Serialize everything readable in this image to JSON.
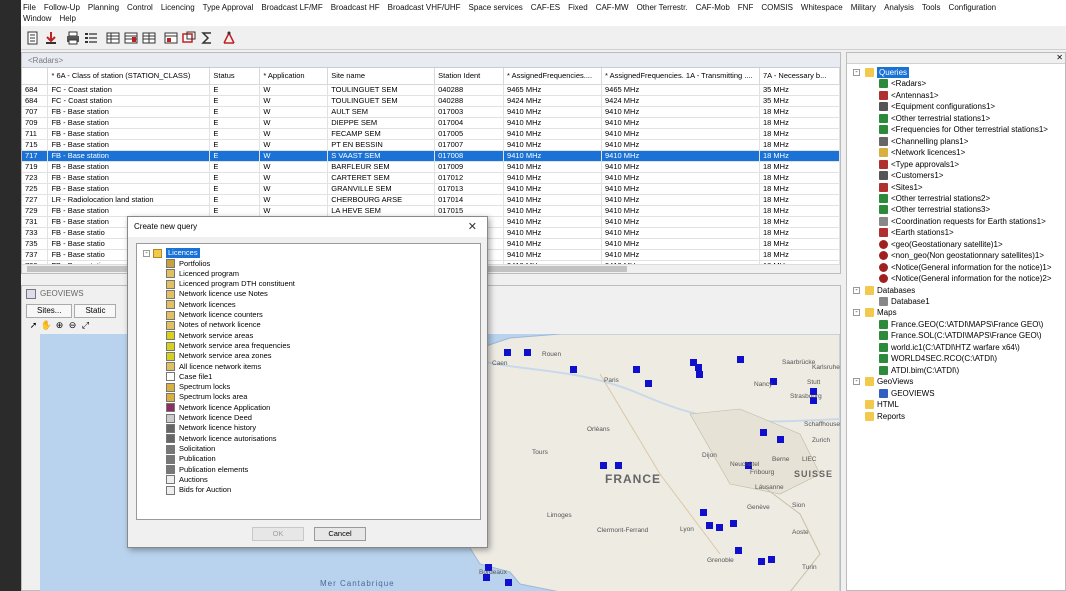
{
  "menu": {
    "row1": [
      "File",
      "Follow-Up",
      "Planning",
      "Control",
      "Licencing",
      "Type Approval",
      "Broadcast LF/MF",
      "Broadcast HF",
      "Broadcast VHF/UHF",
      "Space services",
      "CAF-ES",
      "Fixed",
      "CAF-MW",
      "Other Terrestr.",
      "CAF-Mob",
      "FNF",
      "COMSIS",
      "Whitespace",
      "Military",
      "Analysis",
      "Tools",
      "Configuration"
    ],
    "row2": [
      "Window",
      "Help"
    ]
  },
  "table": {
    "title": "<Radars>",
    "columns": [
      "",
      "* 6A - Class of station (STATION_CLASS)",
      "Status",
      "* Application",
      "Site name",
      "Station Ident",
      "* AssignedFrequencies....",
      "* AssignedFrequencies. 1A - Transmitting ....",
      "7A - Necessary b..."
    ],
    "rows": [
      [
        "684",
        "FC - Coast station",
        "E",
        "W",
        "TOULINGUET SEM",
        "040288",
        "9465 MHz",
        "9465 MHz",
        "35 MHz"
      ],
      [
        "684",
        "FC - Coast station",
        "E",
        "W",
        "TOULINGUET SEM",
        "040288",
        "9424 MHz",
        "9424 MHz",
        "35 MHz"
      ],
      [
        "707",
        "FB - Base station",
        "E",
        "W",
        "AULT SEM",
        "017003",
        "9410 MHz",
        "9410 MHz",
        "18 MHz"
      ],
      [
        "709",
        "FB - Base station",
        "E",
        "W",
        "DIEPPE SEM",
        "017004",
        "9410 MHz",
        "9410 MHz",
        "18 MHz"
      ],
      [
        "711",
        "FB - Base station",
        "E",
        "W",
        "FECAMP SEM",
        "017005",
        "9410 MHz",
        "9410 MHz",
        "18 MHz"
      ],
      [
        "715",
        "FB - Base station",
        "E",
        "W",
        "PT EN BESSIN",
        "017007",
        "9410 MHz",
        "9410 MHz",
        "18 MHz"
      ],
      [
        "717",
        "FB - Base station",
        "E",
        "W",
        "S VAAST SEM",
        "017008",
        "9410 MHz",
        "9410 MHz",
        "18 MHz"
      ],
      [
        "719",
        "FB - Base station",
        "E",
        "W",
        "BARFLEUR SEM",
        "017009",
        "9410 MHz",
        "9410 MHz",
        "18 MHz"
      ],
      [
        "723",
        "FB - Base station",
        "E",
        "W",
        "CARTERET SEM",
        "017012",
        "9410 MHz",
        "9410 MHz",
        "18 MHz"
      ],
      [
        "725",
        "FB - Base station",
        "E",
        "W",
        "GRANVILLE SEM",
        "017013",
        "9410 MHz",
        "9410 MHz",
        "18 MHz"
      ],
      [
        "727",
        "LR - Radiolocation land station",
        "E",
        "W",
        "CHERBOURG ARSE",
        "017014",
        "9410 MHz",
        "9410 MHz",
        "18 MHz"
      ],
      [
        "729",
        "FB - Base station",
        "E",
        "W",
        "LA HEVE SEM",
        "017015",
        "9410 MHz",
        "9410 MHz",
        "18 MHz"
      ],
      [
        "731",
        "FB - Base station",
        "E",
        "W",
        "S CAST SEM",
        "017016",
        "9410 MHz",
        "9410 MHz",
        "18 MHz"
      ],
      [
        "733",
        "FB - Base statio",
        "",
        "",
        "",
        "",
        "9410 MHz",
        "9410 MHz",
        "18 MHz"
      ],
      [
        "735",
        "FB - Base statio",
        "",
        "",
        "",
        "",
        "9410 MHz",
        "9410 MHz",
        "18 MHz"
      ],
      [
        "737",
        "FB - Base statio",
        "",
        "",
        "",
        "",
        "9410 MHz",
        "9410 MHz",
        "18 MHz"
      ],
      [
        "739",
        "FB - Base statio",
        "",
        "",
        "",
        "",
        "9410 MHz",
        "9410 MHz",
        "18 MHz"
      ]
    ],
    "selected_row": 6
  },
  "geoviews": {
    "title": "GEOVIEWS",
    "tabs": [
      "Sites...",
      "Static"
    ],
    "map_labels": {
      "france": "FRANCE",
      "suisse": "SUISSE",
      "sea": "Mer Cantabrique",
      "cities": [
        "Rouen",
        "Caen",
        "Paris",
        "Orléans",
        "Tours",
        "Dijon",
        "Limoges",
        "Clermont-Ferrand",
        "Lyon",
        "Grenoble",
        "Genève",
        "Sion",
        "Aoste",
        "Turin",
        "Bordeaux",
        "Strasbourg",
        "Karlsruhe",
        "Stutt",
        "Saarbrücke",
        "Nancy",
        "Schaffhouse",
        "Zurich",
        "Berne",
        "Neuchâtel",
        "Fribourg",
        "Lausanne",
        "LIEC",
        "M"
      ]
    }
  },
  "tree": {
    "items": [
      {
        "label": "Queries",
        "level": 0,
        "icon": "folder-icon",
        "selected": true,
        "exp": "-"
      },
      {
        "label": "<Radars>",
        "level": 1,
        "icon": "radar-icon"
      },
      {
        "label": "<Antennas1>",
        "level": 1,
        "icon": "antenna-icon"
      },
      {
        "label": "<Equipment configurations1>",
        "level": 1,
        "icon": "equipment-icon"
      },
      {
        "label": "<Other terrestrial stations1>",
        "level": 1,
        "icon": "tower-icon"
      },
      {
        "label": "<Frequencies for Other terrestrial stations1>",
        "level": 1,
        "icon": "tower-icon"
      },
      {
        "label": "<Channelling plans1>",
        "level": 1,
        "icon": "channel-icon"
      },
      {
        "label": "<Network licences1>",
        "level": 1,
        "icon": "licence-icon"
      },
      {
        "label": "<Type approvals1>",
        "level": 1,
        "icon": "approval-icon"
      },
      {
        "label": "<Customers1>",
        "level": 1,
        "icon": "customer-icon"
      },
      {
        "label": "<Sites1>",
        "level": 1,
        "icon": "site-icon"
      },
      {
        "label": "<Other terrestrial stations2>",
        "level": 1,
        "icon": "tower-icon"
      },
      {
        "label": "<Other terrestrial stations3>",
        "level": 1,
        "icon": "tower-icon"
      },
      {
        "label": "<Coordination requests for Earth stations1>",
        "level": 1,
        "icon": "coordination-icon"
      },
      {
        "label": "<Earth stations1>",
        "level": 1,
        "icon": "earth-station-icon"
      },
      {
        "label": "<geo(Geostationary satellite)1>",
        "level": 1,
        "icon": "satellite-icon"
      },
      {
        "label": "<non_geo(Non geostationnary satellites)1>",
        "level": 1,
        "icon": "satellite-icon"
      },
      {
        "label": "<Notice(General information for the notice)1>",
        "level": 1,
        "icon": "satellite-icon"
      },
      {
        "label": "<Notice(General information for the notice)2>",
        "level": 1,
        "icon": "satellite-icon"
      },
      {
        "label": "Databases",
        "level": 0,
        "icon": "folder-icon",
        "exp": "-"
      },
      {
        "label": "Database1",
        "level": 1,
        "icon": "database-icon"
      },
      {
        "label": "Maps",
        "level": 0,
        "icon": "folder-icon",
        "exp": "-"
      },
      {
        "label": "France.GEO(C:\\ATDI\\MAPS\\France GEO\\)",
        "level": 1,
        "icon": "map-icon"
      },
      {
        "label": "France.SOL(C:\\ATDI\\MAPS\\France GEO\\)",
        "level": 1,
        "icon": "map-icon"
      },
      {
        "label": "world.ic1(C:\\ATDI\\HTZ warfare x64\\)",
        "level": 1,
        "icon": "map-icon"
      },
      {
        "label": "WORLD4SEC.RCO(C:\\ATDI\\)",
        "level": 1,
        "icon": "map-icon"
      },
      {
        "label": "ATDI.bim(C:\\ATDI\\)",
        "level": 1,
        "icon": "map-icon"
      },
      {
        "label": "GeoViews",
        "level": 0,
        "icon": "folder-icon",
        "exp": "-"
      },
      {
        "label": "GEOVIEWS",
        "level": 1,
        "icon": "geoview-icon"
      },
      {
        "label": "HTML",
        "level": 0,
        "icon": "folder-icon"
      },
      {
        "label": "Reports",
        "level": 0,
        "icon": "folder-icon"
      }
    ]
  },
  "dialog": {
    "title": "Create new query",
    "root": "Licences",
    "items": [
      {
        "label": "Portfolios",
        "icon": "portfolio-icon"
      },
      {
        "label": "Licenced program",
        "icon": "licence-icon"
      },
      {
        "label": "Licenced program DTH constituent",
        "icon": "licence-icon"
      },
      {
        "label": "Network licence use Notes",
        "icon": "licence-icon"
      },
      {
        "label": "Network licences",
        "icon": "licence-icon"
      },
      {
        "label": "Network licence counters",
        "icon": "licence-icon"
      },
      {
        "label": "Notes of network licence",
        "icon": "licence-icon"
      },
      {
        "label": "Network service areas",
        "icon": "service-area-icon"
      },
      {
        "label": "Network service area frequencies",
        "icon": "service-area-icon"
      },
      {
        "label": "Network service area zones",
        "icon": "service-area-icon"
      },
      {
        "label": "All licence network items",
        "icon": "licence-icon"
      },
      {
        "label": "Case file1",
        "icon": "case-icon"
      },
      {
        "label": "Spectrum locks",
        "icon": "lock-icon"
      },
      {
        "label": "Spectrum locks area",
        "icon": "lock-icon"
      },
      {
        "label": "Network licence Application",
        "icon": "application-icon"
      },
      {
        "label": "Network licence Deed",
        "icon": "deed-icon"
      },
      {
        "label": "Network licence history",
        "icon": "history-icon"
      },
      {
        "label": "Network licence autorisations",
        "icon": "history-icon"
      },
      {
        "label": "Solicitation",
        "icon": "solicitation-icon"
      },
      {
        "label": "Publication",
        "icon": "publication-icon"
      },
      {
        "label": "Publication elements",
        "icon": "publication-icon"
      },
      {
        "label": "Auctions",
        "icon": "auction-icon"
      },
      {
        "label": "Bids for Auction",
        "icon": "auction-icon"
      }
    ],
    "ok_label": "OK",
    "cancel_label": "Cancel",
    "close_glyph": "✕"
  },
  "colors": {
    "selection": "#1a72d6",
    "station_marker": "#1010cc",
    "map_sea": "#b9d3ee",
    "map_land": "#eeebe3"
  }
}
